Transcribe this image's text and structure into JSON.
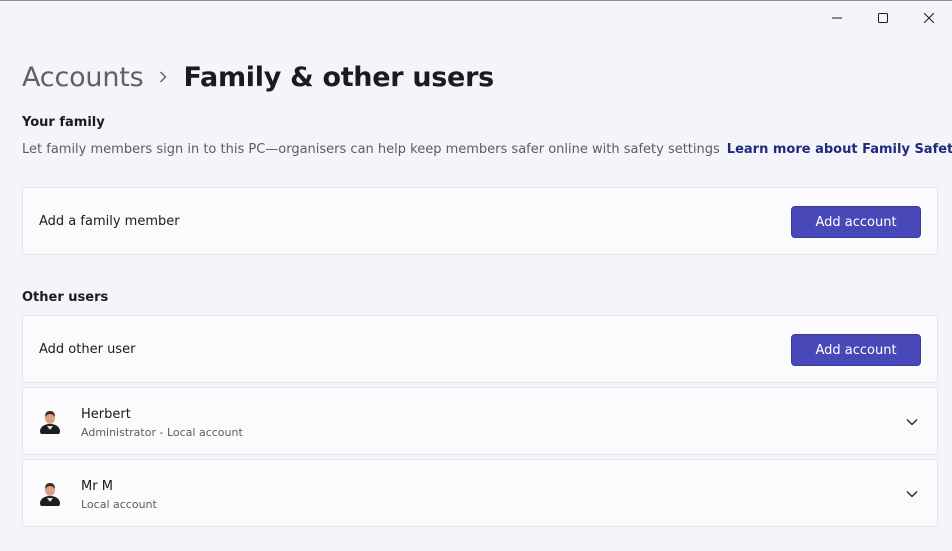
{
  "window": {
    "minimize_icon": "minimize-icon",
    "maximize_icon": "maximize-icon",
    "close_icon": "close-icon"
  },
  "breadcrumb": {
    "parent": "Accounts",
    "current": "Family & other users"
  },
  "your_family": {
    "title": "Your family",
    "description": "Let family members sign in to this PC—organisers can help keep members safer online with safety settings",
    "link": "Learn more about Family Safety",
    "add_label": "Add a family member",
    "add_button": "Add account"
  },
  "other_users": {
    "title": "Other users",
    "add_label": "Add other user",
    "add_button": "Add account",
    "users": [
      {
        "name": "Herbert",
        "subtitle": "Administrator - Local account"
      },
      {
        "name": "Mr M",
        "subtitle": "Local account"
      }
    ]
  },
  "colors": {
    "accent": "#4848b8",
    "link": "#1f2a7a",
    "background": "#f3f5fa",
    "card": "#fbfbfd"
  }
}
